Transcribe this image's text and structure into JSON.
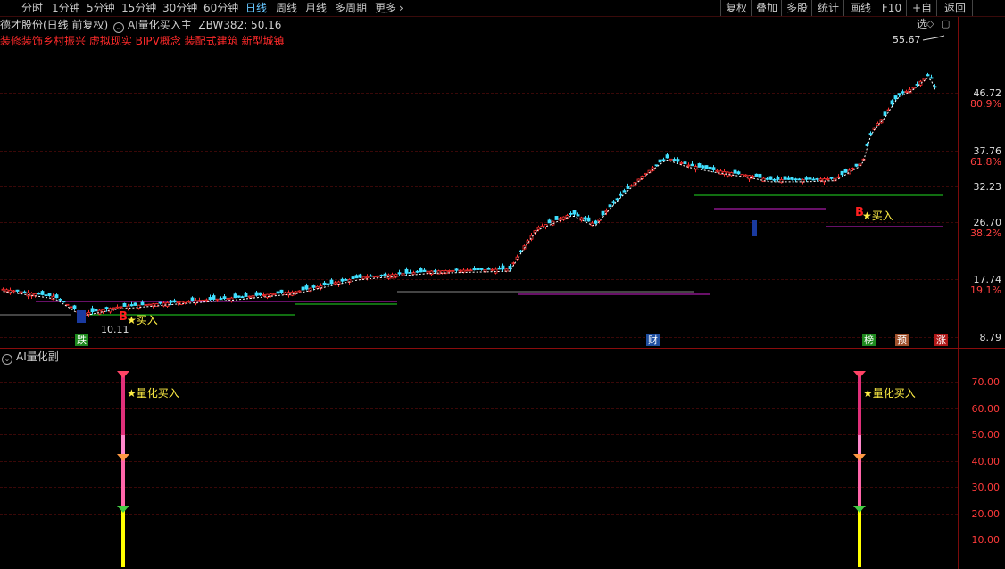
{
  "toolbar": {
    "periods": [
      "分时",
      "1分钟",
      "5分钟",
      "15分钟",
      "30分钟",
      "60分钟",
      "日线",
      "周线",
      "月线",
      "多周期",
      "更多"
    ],
    "active_period": "日线",
    "more_arrow": "›",
    "right_buttons": [
      "复权",
      "叠加",
      "多股",
      "统计",
      "画线",
      "F10",
      "+自选",
      "返回"
    ]
  },
  "main_panel": {
    "stock_label": "德才股份(日线 前复权)",
    "indicator_name": "AI量化买入主",
    "indicator_value": "ZBW382: 50.16",
    "concepts": "装修装饰乡村振兴 虚拟现实 BIPV概念 装配式建筑 新型城镇",
    "high_label": "55.67",
    "low_label": "10.11",
    "price_ticks": [
      "46.72",
      "37.76",
      "32.23",
      "26.70",
      "17.74",
      "8.79"
    ],
    "pct_ticks": [
      "80.9%",
      "61.8%",
      "38.2%",
      "19.1%"
    ],
    "buy_text": "★买入",
    "b_label": "B",
    "event_tags": [
      {
        "text": "跌",
        "color": "#1e8a1e"
      },
      {
        "text": "财",
        "color": "#1f4fa0"
      },
      {
        "text": "榜",
        "color": "#1e8a1e"
      },
      {
        "text": "预",
        "color": "#a0522d"
      },
      {
        "text": "涨",
        "color": "#b01818"
      }
    ],
    "colors": {
      "up": "#ff3030",
      "down": "#40e0ff",
      "ma": "#ffffff",
      "support": "#22dd22",
      "resist": "#d020d0"
    }
  },
  "sub_panel": {
    "indicator_name": "AI量化副",
    "signal_text": "★量化买入",
    "ticks": [
      "70.00",
      "60.00",
      "50.00",
      "40.00",
      "30.00",
      "20.00",
      "10.00"
    ]
  }
}
